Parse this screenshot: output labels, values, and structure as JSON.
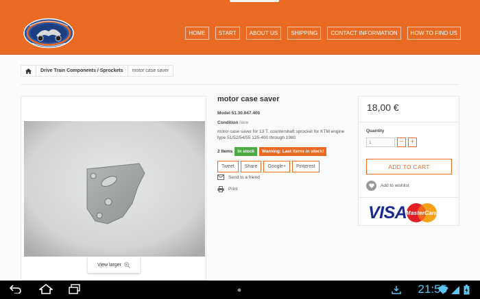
{
  "header": {
    "logo_alt": "ANDRE HORVATH · Ersatzteile",
    "nav": [
      "HOME",
      "START",
      "ABOUT US",
      "SHIPPING",
      "CONTACT INFORMATION",
      "HOW TO FIND US"
    ]
  },
  "breadcrumb": {
    "home_icon": "home-icon",
    "items": [
      "Drive Train Components / Sprockets",
      "motor case saver"
    ]
  },
  "product": {
    "view_larger": "View larger",
    "title": "motor case saver",
    "model_label": "Model",
    "model_value": "51.30.047.400",
    "condition_label": "Condition",
    "condition_value": "New",
    "description": "motor case saver for 13 T. countershaft sprocket for KTM engine type 51/52/54/55 125-400 through 1980",
    "quantity_available": "2 Items",
    "in_stock": "In stock",
    "warning": "Warning: Last items in stock!",
    "share": [
      "Tweet",
      "Share",
      "Google+",
      "Pinterest"
    ],
    "send_to_friend": "Send to a friend",
    "print": "Print"
  },
  "buy_box": {
    "price": "18,00 €",
    "quantity_label": "Quantity",
    "quantity_value": "1",
    "minus": "−",
    "plus": "+",
    "add_to_cart": "ADD TO CART",
    "add_to_wishlist": "Add to wishlist",
    "visa": "VISA",
    "mastercard": "MasterCard"
  },
  "system_bar": {
    "time": "21:55"
  },
  "colors": {
    "accent": "#e96a22",
    "in_stock": "#4ca944",
    "clock": "#5cc4f0"
  }
}
